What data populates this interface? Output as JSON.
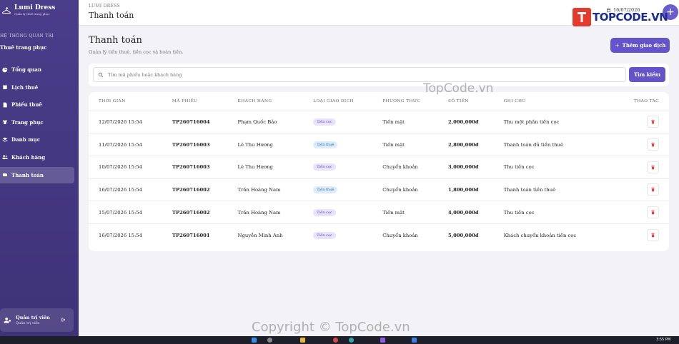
{
  "brand": {
    "name": "Lumi Dress",
    "sub": "Quản lý thuê trang phục"
  },
  "sidebar": {
    "section": "HỆ THỐNG QUẢN TRỊ",
    "group": "Thuê trang phục",
    "items": [
      {
        "label": "Tổng quan",
        "icon": "chart-pie-icon"
      },
      {
        "label": "Lịch thuê",
        "icon": "calendar-icon"
      },
      {
        "label": "Phiếu thuê",
        "icon": "file-icon"
      },
      {
        "label": "Trang phục",
        "icon": "shirt-icon"
      },
      {
        "label": "Danh mục",
        "icon": "layers-icon"
      },
      {
        "label": "Khách hàng",
        "icon": "users-icon"
      },
      {
        "label": "Thanh toán",
        "icon": "wallet-icon",
        "active": true
      }
    ],
    "user": {
      "name": "Quản trị viên",
      "role": "Quản trị viên"
    }
  },
  "topbar": {
    "app": "LUMI DRESS",
    "page": "Thanh toán",
    "date": "16/07/2026",
    "add": "+"
  },
  "header": {
    "title": "Thanh toán",
    "subtitle": "Quản lý tiền thuê, tiền cọc và hoàn tiền.",
    "add_button": "Thêm giao dịch"
  },
  "search": {
    "placeholder": "Tìm mã phiếu hoặc khách hàng",
    "button": "Tìm kiếm"
  },
  "table": {
    "headers": [
      "THỜI GIAN",
      "MÃ PHIẾU",
      "KHÁCH HÀNG",
      "LOẠI GIAO DỊCH",
      "PHƯƠNG THỨC",
      "SỐ TIỀN",
      "GHI CHÚ",
      "THAO TÁC"
    ],
    "rows": [
      {
        "time": "12/07/2026 15:54",
        "code": "TP260716004",
        "customer": "Phạm Quốc Bảo",
        "type": "Tiền cọc",
        "method": "Tiền mặt",
        "amount": "2,000,000đ",
        "note": "Thu một phần tiền cọc"
      },
      {
        "time": "11/07/2026 15:54",
        "code": "TP260716003",
        "customer": "Lê Thu Hương",
        "type": "Tiền thuê",
        "method": "Tiền mặt",
        "amount": "2,800,000đ",
        "note": "Thanh toán đủ tiền thuê"
      },
      {
        "time": "10/07/2026 15:54",
        "code": "TP260716003",
        "customer": "Lê Thu Hương",
        "type": "Tiền cọc",
        "method": "Chuyển khoản",
        "amount": "3,000,000đ",
        "note": "Thu tiền cọc"
      },
      {
        "time": "16/07/2026 15:54",
        "code": "TP260716002",
        "customer": "Trần Hoàng Nam",
        "type": "Tiền thuê",
        "method": "Chuyển khoản",
        "amount": "1,800,000đ",
        "note": "Thanh toán tiền thuê"
      },
      {
        "time": "15/07/2026 15:54",
        "code": "TP260716002",
        "customer": "Trần Hoàng Nam",
        "type": "Tiền cọc",
        "method": "Tiền mặt",
        "amount": "4,000,000đ",
        "note": "Thu tiền cọc"
      },
      {
        "time": "16/07/2026 15:54",
        "code": "TP260716001",
        "customer": "Nguyễn Minh Anh",
        "type": "Tiền cọc",
        "method": "Chuyển khoản",
        "amount": "5,000,000đ",
        "note": "Khách chuyển khoản tiền cọc"
      }
    ]
  },
  "overlays": {
    "logo_text": "TOPCODE.VN",
    "mid_watermark": "TopCode.vn",
    "copyright": "Copyright © TopCode.vn"
  },
  "taskbar": {
    "time": "3:55 PM"
  },
  "colors": {
    "accent": "#6554c9",
    "sidebar": "#463a85",
    "danger": "#e04545"
  }
}
